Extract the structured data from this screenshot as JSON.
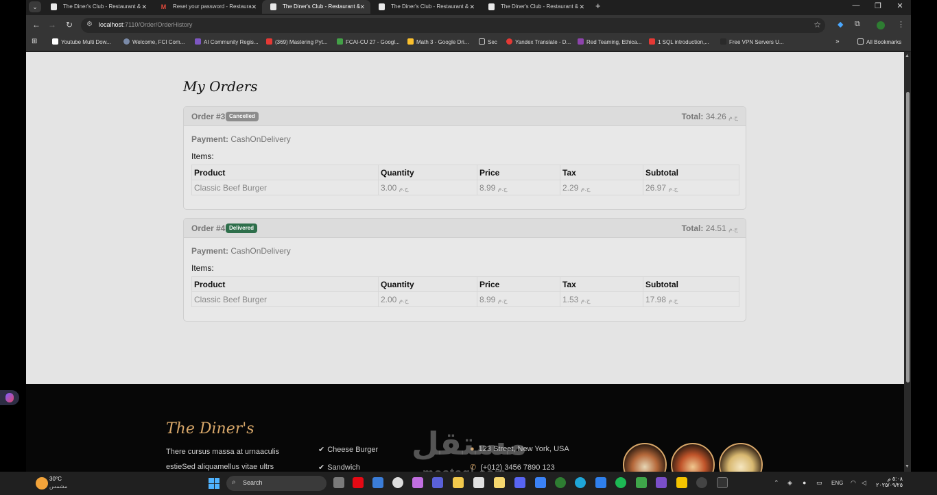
{
  "browser": {
    "tabs": [
      {
        "label": "The Diner's Club - Restaurant &",
        "active": false
      },
      {
        "label": "Reset your password - Restaura",
        "active": false
      },
      {
        "label": "The Diner's Club - Restaurant &",
        "active": true
      },
      {
        "label": "The Diner's Club - Restaurant &",
        "active": false
      },
      {
        "label": "The Diner's Club - Restaurant &",
        "active": false
      }
    ],
    "url_host": "localhost",
    "url_path": ":7110/Order/OrderHistory",
    "bookmarks": [
      "Youtube Multi Dow...",
      "Welcome, FCI Com...",
      "AI Community Regis...",
      "(369) Mastering Pyt...",
      "FCAI-CU 27 - Googl...",
      "Math 3 - Google Dri...",
      "Sec",
      "Yandex Translate - D...",
      "Red Teaming, Ethica...",
      "1 SQL introduction,...",
      "Free VPN Servers U..."
    ],
    "all_bookmarks": "All Bookmarks"
  },
  "page": {
    "title": "My Orders",
    "orders": [
      {
        "number": "Order #3",
        "status": "Cancelled",
        "total_label": "Total:",
        "total_value": "34.26",
        "payment_label": "Payment:",
        "payment_value": "CashOnDelivery",
        "items_label": "Items:",
        "headers": [
          "Product",
          "Quantity",
          "Price",
          "Tax",
          "Subtotal"
        ],
        "rows": [
          {
            "product": "Classic Beef Burger",
            "quantity": "3.00",
            "price": "8.99",
            "tax": "2.29",
            "subtotal": "26.97"
          }
        ]
      },
      {
        "number": "Order #4",
        "status": "Delivered",
        "total_label": "Total:",
        "total_value": "24.51",
        "payment_label": "Payment:",
        "payment_value": "CashOnDelivery",
        "items_label": "Items:",
        "headers": [
          "Product",
          "Quantity",
          "Price",
          "Tax",
          "Subtotal"
        ],
        "rows": [
          {
            "product": "Classic Beef Burger",
            "quantity": "2.00",
            "price": "8.99",
            "tax": "1.53",
            "subtotal": "17.98"
          }
        ]
      }
    ],
    "currency": "ج.م"
  },
  "footer": {
    "brand": "The Diner's",
    "text_line1": "There cursus massa at urnaaculis",
    "text_line2": "estieSed aliquamellus vitae ultrs",
    "links": [
      "Cheese Burger",
      "Sandwich"
    ],
    "address": "123 Street, New York, USA",
    "phone": "(+012) 3456 7890 123"
  },
  "watermark": {
    "arabic": "مستقل",
    "latin": "mostaql.com"
  },
  "taskbar": {
    "temp": "30°C",
    "weather": "مشمس",
    "search": "Search",
    "lang": "ENG",
    "time": "٥:٠٨ م",
    "date": "٢٠٢٥/٠٩/٢٥"
  },
  "colors": {
    "accent": "#d9a86a",
    "delivered": "#2e6f4b",
    "cancelled": "#8c8c8c"
  }
}
